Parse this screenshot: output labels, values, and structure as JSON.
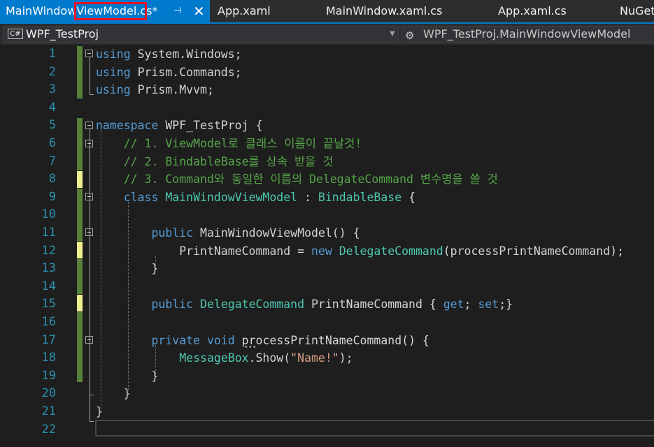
{
  "tabs": {
    "active": {
      "label": "MainWindowViewModel.cs*",
      "pin": "⊣",
      "close": "✕"
    },
    "others": [
      "App.xaml",
      "MainWindow.xaml.cs",
      "App.xaml.cs",
      "NuGet"
    ]
  },
  "navbar": {
    "project_badge": "C#",
    "project": "WPF_TestProj",
    "member": "WPF_TestProj.MainWindowViewModel"
  },
  "editor": {
    "line_numbers": [
      "1",
      "2",
      "3",
      "4",
      "5",
      "6",
      "7",
      "8",
      "9",
      "10",
      "11",
      "12",
      "13",
      "14",
      "15",
      "16",
      "17",
      "18",
      "19",
      "20",
      "21",
      "22"
    ],
    "lines": [
      [
        [
          "kw",
          "using"
        ],
        [
          "pl",
          " System.Windows;"
        ]
      ],
      [
        [
          "kw",
          "using"
        ],
        [
          "pl",
          " Prism.Commands;"
        ]
      ],
      [
        [
          "kw",
          "using"
        ],
        [
          "pl",
          " Prism.Mvvm;"
        ]
      ],
      [],
      [
        [
          "kw",
          "namespace"
        ],
        [
          "pl",
          " WPF_TestProj {"
        ]
      ],
      [
        [
          "pl",
          "    "
        ],
        [
          "cm",
          "// 1. ViewModel로 클래스 이름이 끝날것!"
        ]
      ],
      [
        [
          "pl",
          "    "
        ],
        [
          "cm",
          "// 2. BindableBase를 상속 받을 것"
        ]
      ],
      [
        [
          "pl",
          "    "
        ],
        [
          "cm",
          "// 3. Command와 동일한 이름의 DelegateCommand 변수명을 쓸 것"
        ]
      ],
      [
        [
          "pl",
          "    "
        ],
        [
          "kw",
          "class"
        ],
        [
          "pl",
          " "
        ],
        [
          "ty",
          "MainWindowViewModel"
        ],
        [
          "pl",
          " : "
        ],
        [
          "ty",
          "BindableBase"
        ],
        [
          "pl",
          " {"
        ]
      ],
      [],
      [
        [
          "pl",
          "        "
        ],
        [
          "kw",
          "public"
        ],
        [
          "pl",
          " MainWindowViewModel() {"
        ]
      ],
      [
        [
          "pl",
          "            PrintNameCommand = "
        ],
        [
          "kw",
          "new"
        ],
        [
          "pl",
          " "
        ],
        [
          "ty",
          "DelegateCommand"
        ],
        [
          "pl",
          "(processPrintNameCommand);"
        ]
      ],
      [
        [
          "pl",
          "        }"
        ]
      ],
      [],
      [
        [
          "pl",
          "        "
        ],
        [
          "kw",
          "public"
        ],
        [
          "pl",
          " "
        ],
        [
          "ty",
          "DelegateCommand"
        ],
        [
          "pl",
          " PrintNameCommand { "
        ],
        [
          "kw",
          "get"
        ],
        [
          "pl",
          "; "
        ],
        [
          "kw",
          "set"
        ],
        [
          "pl",
          ";}"
        ]
      ],
      [],
      [
        [
          "pl",
          "        "
        ],
        [
          "kw",
          "private"
        ],
        [
          "pl",
          " "
        ],
        [
          "kw",
          "void"
        ],
        [
          "pl",
          " processPrintNameCommand() {"
        ]
      ],
      [
        [
          "pl",
          "            "
        ],
        [
          "ty",
          "MessageBox"
        ],
        [
          "pl",
          ".Show("
        ],
        [
          "st",
          "\"Name!\""
        ],
        [
          "pl",
          ");"
        ]
      ],
      [
        [
          "pl",
          "        }"
        ]
      ],
      [
        [
          "pl",
          "    }"
        ]
      ],
      [
        [
          "pl",
          "}"
        ]
      ],
      []
    ],
    "dots": "•••"
  },
  "colors": {
    "keyword": "#569cd6",
    "type": "#4ec9b0",
    "comment": "#57a64a",
    "string": "#d69d85",
    "line_number": "#2b91af",
    "active_tab": "#007acc",
    "change_saved": "#57803a",
    "change_unsaved": "#efef91",
    "highlight_box": "#e81123"
  }
}
